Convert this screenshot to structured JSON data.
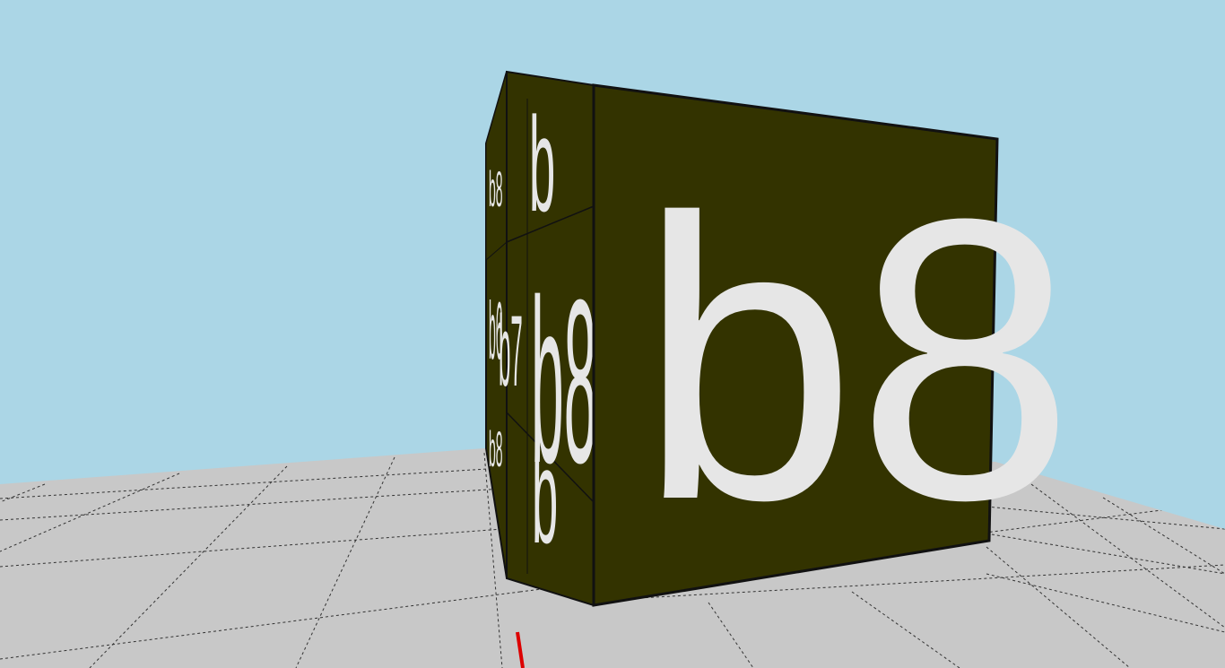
{
  "scene": {
    "sky_color": "#ABD6E6",
    "floor_color": "#C8C8C8",
    "grid_line_color": "#333333",
    "box_face_color": "#333300",
    "box_edge_color": "#111111",
    "label_color": "#E6E6E6",
    "axis_marker_color": "#DD0000"
  },
  "boxes": {
    "front_label": "b8",
    "side_mid_label": "b8",
    "side_mid_small_label": "b7",
    "side_mid_tiny_label": "b6",
    "side_top_label": "b",
    "side_bottom_label": "b",
    "back_top_label": "b8",
    "back_bottom_label": "b8"
  }
}
